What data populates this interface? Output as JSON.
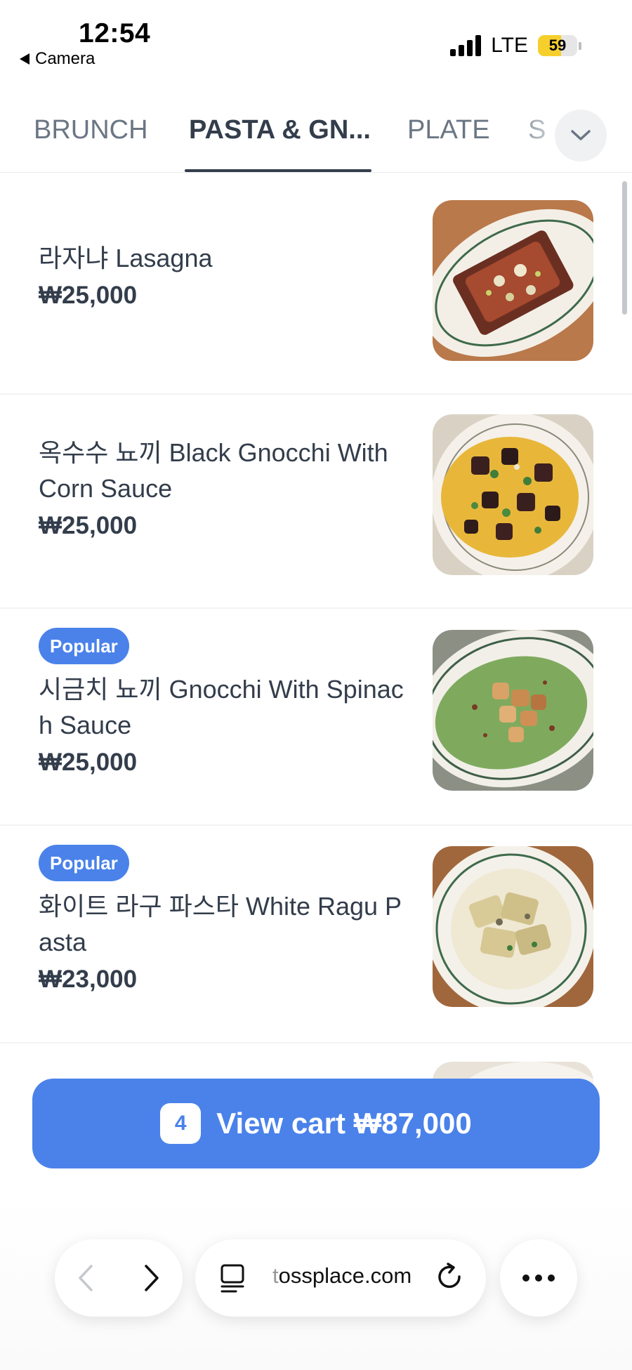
{
  "status_bar": {
    "time": "12:54",
    "back_label": "Camera",
    "network": "LTE",
    "battery_level": "59",
    "battery_fraction": 0.59,
    "signal_icon": "signal-bars-icon",
    "battery_color": "#f6cf2c"
  },
  "tabs": {
    "items": [
      {
        "label": "BRUNCH"
      },
      {
        "label": "PASTA & GN..."
      },
      {
        "label": "PLATE"
      },
      {
        "label": "S"
      }
    ],
    "active_index": 1,
    "more_icon": "chevron-down-icon"
  },
  "menu": {
    "items": [
      {
        "name": "라자냐 Lasagna",
        "price": "₩25,000",
        "badge": "",
        "image": "lasagna-dish-photo"
      },
      {
        "name": "옥수수 뇨끼 Black Gnocchi With Corn Sauce",
        "price": "₩25,000",
        "badge": "",
        "image": "black-gnocchi-dish-photo"
      },
      {
        "name": "시금치 뇨끼 Gnocchi With Spinach Sauce",
        "price": "₩25,000",
        "badge": "Popular",
        "image": "spinach-gnocchi-dish-photo"
      },
      {
        "name": "화이트 라구 파스타 White Ragu Pasta",
        "price": "₩23,000",
        "badge": "Popular",
        "image": "white-ragu-pasta-dish-photo"
      }
    ]
  },
  "cart": {
    "count": "4",
    "label": "View cart ₩87,000",
    "color": "#4a82ea"
  },
  "browser": {
    "url_prefix": "t",
    "url_rest": "ossplace.com",
    "back_icon": "chevron-left-icon",
    "forward_icon": "chevron-right-icon",
    "tabs_icon": "page-menu-icon",
    "reload_icon": "reload-icon",
    "more_icon": "more-dots-icon"
  }
}
